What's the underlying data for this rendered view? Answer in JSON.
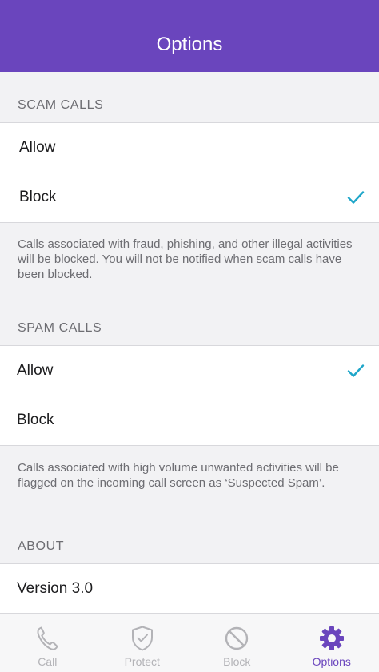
{
  "nav": {
    "title": "Options"
  },
  "colors": {
    "accent": "#6a45bd",
    "check": "#1ea6c9",
    "inactive": "#b3b3b7"
  },
  "scam": {
    "header": "SCAM CALLS",
    "options": [
      {
        "label": "Allow",
        "selected": false
      },
      {
        "label": "Block",
        "selected": true
      }
    ],
    "footnote": "Calls associated with fraud, phishing, and other illegal activities will be blocked. You will not be notified when scam calls have been blocked."
  },
  "spam": {
    "header": "SPAM CALLS",
    "options": [
      {
        "label": "Allow",
        "selected": true
      },
      {
        "label": "Block",
        "selected": false
      }
    ],
    "footnote": "Calls associated with high volume unwanted activities will be flagged on the incoming call screen as ‘Suspected Spam’."
  },
  "about": {
    "header": "ABOUT",
    "version": "Version 3.0"
  },
  "tabs": [
    {
      "label": "Call",
      "icon": "phone-icon",
      "active": false
    },
    {
      "label": "Protect",
      "icon": "shield-check-icon",
      "active": false
    },
    {
      "label": "Block",
      "icon": "block-icon",
      "active": false
    },
    {
      "label": "Options",
      "icon": "gear-icon",
      "active": true
    }
  ]
}
